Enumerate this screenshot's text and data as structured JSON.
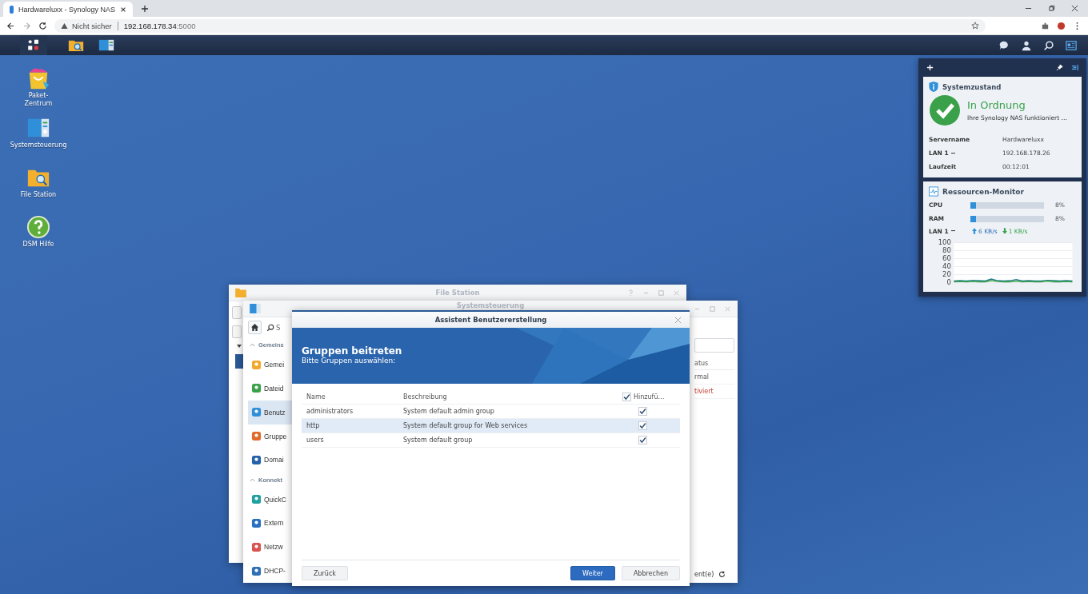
{
  "browser": {
    "tab_title": "Hardwareluxx - Synology NAS",
    "security_label": "Nicht sicher",
    "url_host": "192.168.178.34",
    "url_port": ":5000"
  },
  "desktop_icons": [
    {
      "kind": "package",
      "label": "Paket-\nZentrum"
    },
    {
      "kind": "control",
      "label": "Systemsteuerung"
    },
    {
      "kind": "folder",
      "label": "File Station"
    },
    {
      "kind": "help",
      "label": "DSM Hilfe"
    }
  ],
  "file_station": {
    "title": "File Station"
  },
  "control_panel": {
    "title": "Systemsteuerung",
    "search_placeholder": "S",
    "sidebar": [
      {
        "kind": "header",
        "label": "Gemeins",
        "selected": false
      },
      {
        "kind": "item",
        "label": "Gemei",
        "selected": false
      },
      {
        "kind": "item",
        "label": "Dateid",
        "selected": false
      },
      {
        "kind": "item",
        "label": "Benutz",
        "selected": true
      },
      {
        "kind": "item",
        "label": "Gruppe",
        "selected": false
      },
      {
        "kind": "item",
        "label": "Domai",
        "selected": false
      },
      {
        "kind": "header",
        "label": "Konnekt",
        "selected": false
      },
      {
        "kind": "item",
        "label": "QuickC",
        "selected": false
      },
      {
        "kind": "item",
        "label": "Extern",
        "selected": false
      },
      {
        "kind": "item",
        "label": "Netzw",
        "selected": false
      },
      {
        "kind": "item",
        "label": "DHCP-",
        "selected": false
      }
    ],
    "column": "atus",
    "cells": [
      {
        "text": "rmal",
        "kind": "normal"
      },
      {
        "text": "tiviert",
        "kind": "deactivated"
      }
    ],
    "footer": "ent(e)"
  },
  "wizard": {
    "title": "Assistent Benutzererstellung",
    "heading": "Gruppen beitreten",
    "subheading": "Bitte Gruppen auswählen:",
    "columns": [
      "Name",
      "Beschreibung",
      "Hinzufü…"
    ],
    "header_checked": true,
    "rows": [
      {
        "name": "administrators",
        "description": "System default admin group",
        "checked": true,
        "selected": false
      },
      {
        "name": "http",
        "description": "System default group for Web services",
        "checked": true,
        "selected": true
      },
      {
        "name": "users",
        "description": "System default group",
        "checked": true,
        "selected": false
      }
    ],
    "back": "Zurück",
    "next": "Weiter",
    "cancel": "Abbrechen"
  },
  "system_health": {
    "title": "Systemzustand",
    "status": "In Ordnung",
    "message": "Ihre Synology NAS funktioniert …",
    "rows": [
      {
        "label": "Servername",
        "value": "Hardwareluxx",
        "dropdown": false
      },
      {
        "label": "LAN 1",
        "value": "192.168.178.26",
        "dropdown": true
      },
      {
        "label": "Laufzeit",
        "value": "00:12:01",
        "dropdown": false
      }
    ]
  },
  "resource_monitor": {
    "title": "Ressourcen-Monitor",
    "meters": [
      {
        "label": "CPU",
        "level": 0.08,
        "reading": "8%"
      },
      {
        "label": "RAM",
        "level": 0.08,
        "reading": "8%"
      }
    ],
    "lan": {
      "label": "LAN 1",
      "upload": "6 KB/s",
      "download": "1 KB/s"
    },
    "chart_data": {
      "type": "line",
      "ylim": [
        0,
        100
      ],
      "yticks": [
        0,
        20,
        40,
        60,
        80,
        100
      ],
      "grid": true,
      "series": [
        {
          "color": "#1f7f86",
          "values": [
            4,
            5,
            4,
            6,
            5,
            4,
            9,
            5,
            4,
            5,
            8,
            4,
            5,
            4,
            4,
            6,
            5,
            4,
            5,
            4
          ]
        },
        {
          "color": "#3aa14a",
          "values": [
            2,
            3,
            2,
            3,
            2,
            2,
            5,
            3,
            2,
            2,
            4,
            2,
            3,
            2,
            2,
            4,
            2,
            2,
            3,
            2
          ]
        }
      ]
    }
  }
}
